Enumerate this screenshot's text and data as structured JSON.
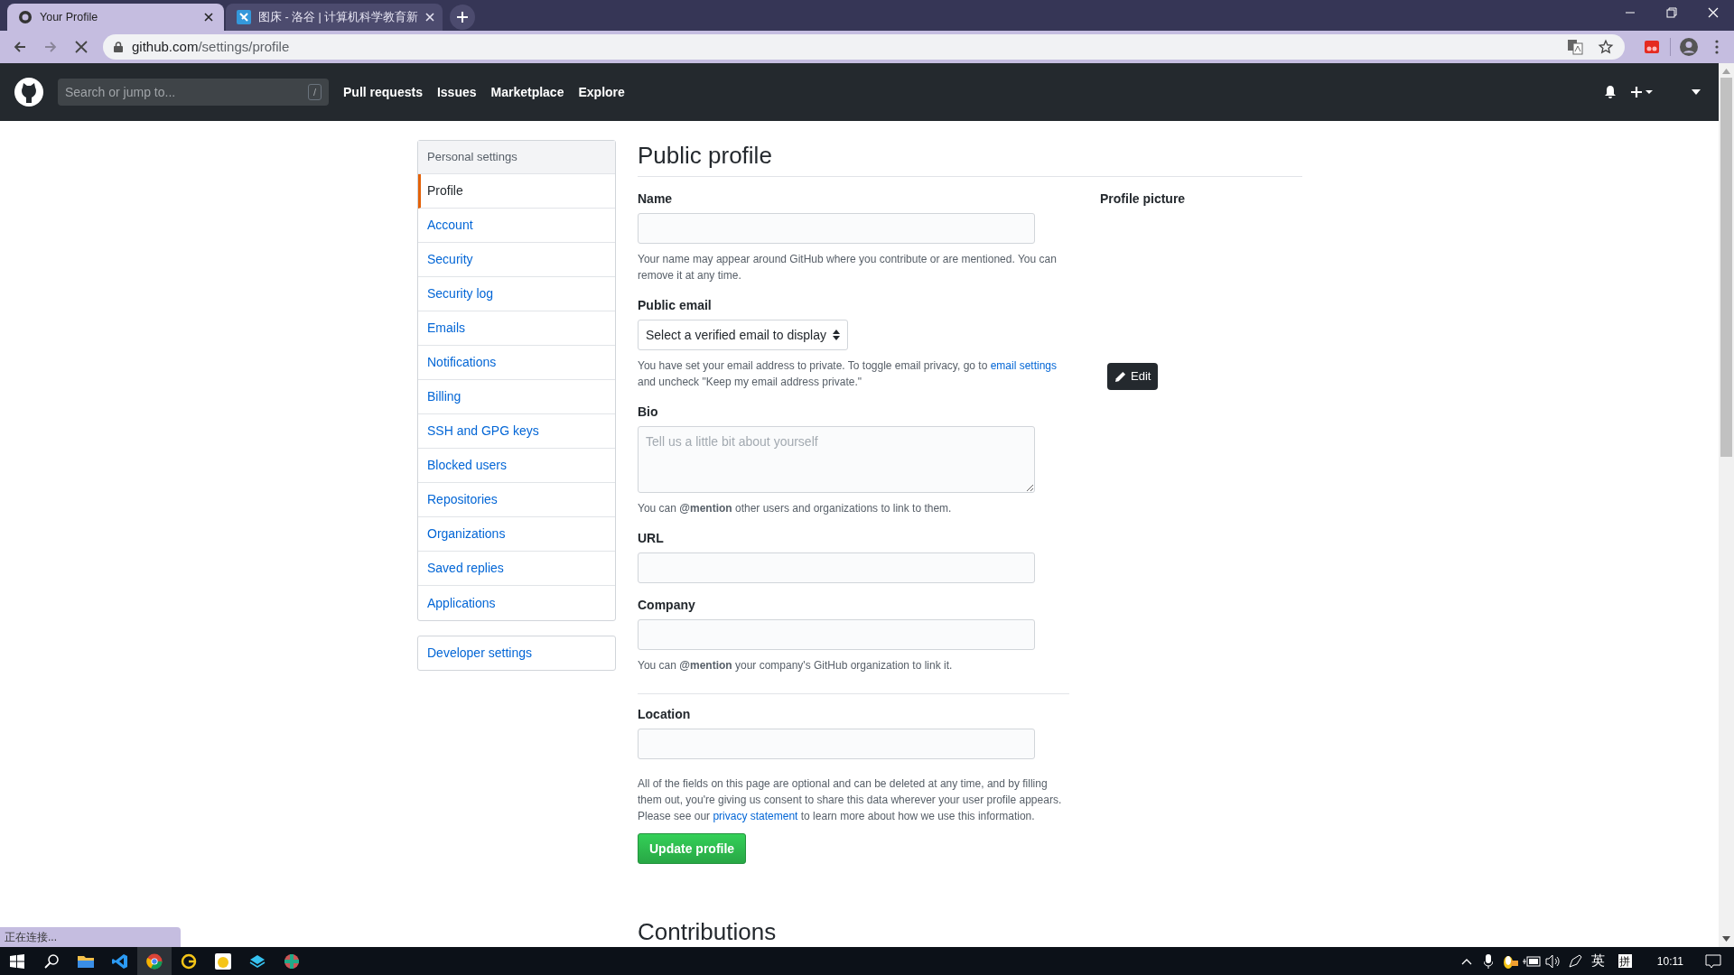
{
  "browser": {
    "tabs": [
      {
        "title": "Your Profile",
        "selected": true
      },
      {
        "title": "图床 - 洛谷 | 计算机科学教育新",
        "selected": false
      }
    ],
    "address": {
      "host": "github.com",
      "path": "/settings/profile"
    }
  },
  "header": {
    "search": {
      "placeholder": "Search or jump to...",
      "shortcut": "/"
    },
    "nav": [
      "Pull requests",
      "Issues",
      "Marketplace",
      "Explore"
    ]
  },
  "sidebar": {
    "heading": "Personal settings",
    "items": [
      {
        "label": "Profile",
        "selected": true
      },
      {
        "label": "Account",
        "selected": false
      },
      {
        "label": "Security",
        "selected": false
      },
      {
        "label": "Security log",
        "selected": false
      },
      {
        "label": "Emails",
        "selected": false
      },
      {
        "label": "Notifications",
        "selected": false
      },
      {
        "label": "Billing",
        "selected": false
      },
      {
        "label": "SSH and GPG keys",
        "selected": false
      },
      {
        "label": "Blocked users",
        "selected": false
      },
      {
        "label": "Repositories",
        "selected": false
      },
      {
        "label": "Organizations",
        "selected": false
      },
      {
        "label": "Saved replies",
        "selected": false
      },
      {
        "label": "Applications",
        "selected": false
      }
    ],
    "developer_settings": "Developer settings"
  },
  "main": {
    "title": "Public profile",
    "fields": [
      {
        "kind": "input",
        "label": "Name",
        "help": [
          {
            "text": "Your name may appear around GitHub where you contribute or are mentioned. You can remove it at any time."
          }
        ]
      },
      {
        "kind": "select",
        "label": "Public email",
        "value": "Select a verified email to display",
        "help": [
          {
            "text": "You have set your email address to private. To toggle email privacy, go to "
          },
          {
            "text": "email settings",
            "link": true
          },
          {
            "text": " and uncheck \"Keep my email address private.\""
          }
        ]
      },
      {
        "kind": "textarea",
        "label": "Bio",
        "placeholder": "Tell us a little bit about yourself",
        "help": [
          {
            "text": "You can **@mention** other users and organizations to link to them."
          }
        ]
      },
      {
        "kind": "input",
        "label": "URL"
      },
      {
        "kind": "input",
        "label": "Company",
        "help": [
          {
            "text": "You can **@mention** your company's GitHub organization to link it."
          }
        ]
      },
      {
        "kind": "divider"
      },
      {
        "kind": "input",
        "label": "Location"
      }
    ],
    "notice": [
      {
        "text": "All of the fields on this page are optional and can be deleted at any time, and by filling them out, you're giving us consent to share this data wherever your user profile appears. Please see our "
      },
      {
        "text": "privacy statement",
        "link": true
      },
      {
        "text": " to learn more about how we use this information."
      }
    ],
    "submit": "Update profile",
    "profile_picture": {
      "label": "Profile picture",
      "edit": "Edit"
    },
    "next_section": "Contributions"
  },
  "status_bubble": "正在连接...",
  "taskbar": {
    "ime_language": "英",
    "ime_mode": "拼",
    "time": "10:11"
  }
}
